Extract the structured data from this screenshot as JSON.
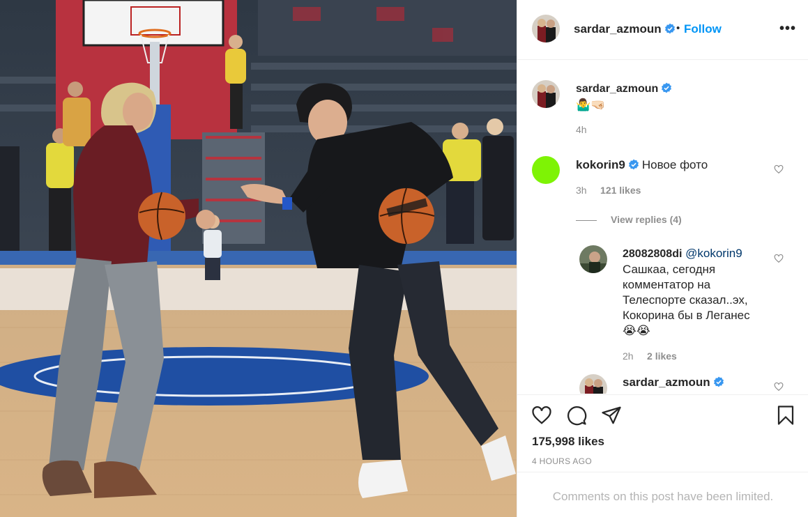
{
  "post": {
    "username": "sardar_azmoun",
    "separator": "•",
    "follow_label": "Follow",
    "more_label": "•••",
    "caption": {
      "username": "sardar_azmoun",
      "text": "🤷‍♂️🤜🏻",
      "time": "4h"
    },
    "comments": [
      {
        "username": "kokorin9",
        "text": "Новое фото",
        "time": "3h",
        "likes": "121 likes",
        "view_replies": "View replies (4)"
      }
    ],
    "replies": [
      {
        "username": "28082808di",
        "mention": "@kokorin9",
        "text": "Сашкаа, сегодня комментатор на Телеспорте сказал..эх, Кокорина бы в Леганес 😭😭",
        "time": "2h",
        "likes": "2 likes"
      },
      {
        "username": "sardar_azmoun"
      }
    ],
    "likes_count": "175,998 likes",
    "timestamp": "4 HOURS AGO",
    "comments_limited": "Comments on this post have been limited."
  },
  "colors": {
    "accent": "#0095f6",
    "verified": "#3897f0",
    "kokorin_avatar": "#7ef305"
  },
  "icons": [
    "verified-badge-icon",
    "heart-icon",
    "comment-icon",
    "share-icon",
    "bookmark-icon",
    "more-icon"
  ]
}
